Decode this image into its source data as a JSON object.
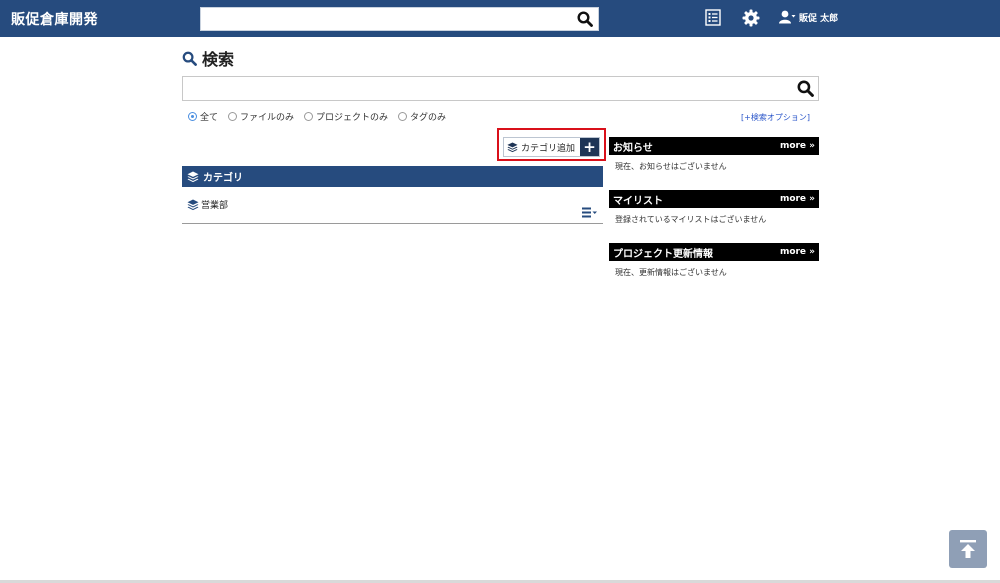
{
  "header": {
    "app_title": "販促倉庫開発",
    "search_value": "",
    "user_name": "販促 太郎",
    "icons": [
      "search-icon",
      "list-icon",
      "gear-icon",
      "user-icon"
    ]
  },
  "search": {
    "title": "検索",
    "value": "",
    "filters": [
      {
        "label": "全て",
        "checked": true
      },
      {
        "label": "ファイルのみ",
        "checked": false
      },
      {
        "label": "プロジェクトのみ",
        "checked": false
      },
      {
        "label": "タグのみ",
        "checked": false
      }
    ],
    "option_link": "[+検索オプション]"
  },
  "category": {
    "add_button_label": "カテゴリ追加",
    "add_button_plus": "+",
    "header": "カテゴリ",
    "items": [
      {
        "label": "営業部"
      }
    ]
  },
  "widgets": [
    {
      "title": "お知らせ",
      "more": "more »",
      "message": "現在、お知らせはございません"
    },
    {
      "title": "マイリスト",
      "more": "more »",
      "message": "登録されているマイリストはございません"
    },
    {
      "title": "プロジェクト更新情報",
      "more": "more »",
      "message": "現在、更新情報はございません"
    }
  ],
  "colors": {
    "header_bg": "#264b7e",
    "highlight": "#d9101a",
    "link": "#2a55c9",
    "to_top_bg": "#8f9fb6"
  }
}
